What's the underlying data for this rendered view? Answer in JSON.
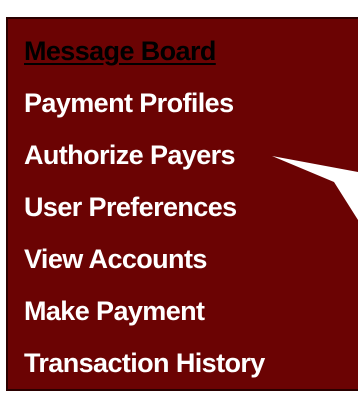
{
  "menu": {
    "items": [
      {
        "label": "Message Board",
        "active": true
      },
      {
        "label": "Payment Profiles",
        "active": false
      },
      {
        "label": "Authorize Payers",
        "active": false
      },
      {
        "label": "User Preferences",
        "active": false
      },
      {
        "label": "View Accounts",
        "active": false
      },
      {
        "label": "Make Payment",
        "active": false
      },
      {
        "label": "Transaction History",
        "active": false
      }
    ]
  },
  "colors": {
    "panel_background": "#6b0303",
    "link_text": "#ffffff",
    "active_link_text": "#000000",
    "callout_arrow": "#ffffff"
  },
  "icons": {
    "callout": "callout-arrow-icon"
  }
}
